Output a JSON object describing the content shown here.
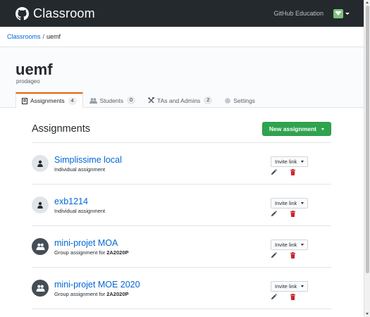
{
  "header": {
    "brand": "Classroom",
    "link": "GitHub Education"
  },
  "breadcrumb": {
    "root": "Classrooms",
    "separator": "/",
    "current": "uemf"
  },
  "org": {
    "title": "uemf",
    "subtitle": "prodageo"
  },
  "tabs": [
    {
      "label": "Assignments",
      "count": "4",
      "active": true,
      "icon": "assignment-icon"
    },
    {
      "label": "Students",
      "count": "0",
      "active": false,
      "icon": "people-icon"
    },
    {
      "label": "TAs and Admins",
      "count": "2",
      "active": false,
      "icon": "tools-icon"
    },
    {
      "label": "Settings",
      "count": null,
      "active": false,
      "icon": "gear-icon"
    }
  ],
  "main": {
    "title": "Assignments",
    "new_button": "New assignment",
    "invite_label": "Invite link",
    "assignments": [
      {
        "title": "Simplissime local",
        "subtitle": "Individual assignment",
        "group": null,
        "type": "individual"
      },
      {
        "title": "exb1214",
        "subtitle": "Individual assignment",
        "group": null,
        "type": "individual"
      },
      {
        "title": "mini-projet MOA",
        "subtitle": "Group assignment for",
        "group": "2A2020P",
        "type": "group"
      },
      {
        "title": "mini-projet MOE 2020",
        "subtitle": "Group assignment for",
        "group": "2A2020P",
        "type": "group"
      }
    ]
  },
  "colors": {
    "header_bg": "#24292e",
    "link": "#0366d6",
    "primary_button": "#2ea44f",
    "active_tab_accent": "#e36209",
    "delete_icon": "#cb2431"
  }
}
